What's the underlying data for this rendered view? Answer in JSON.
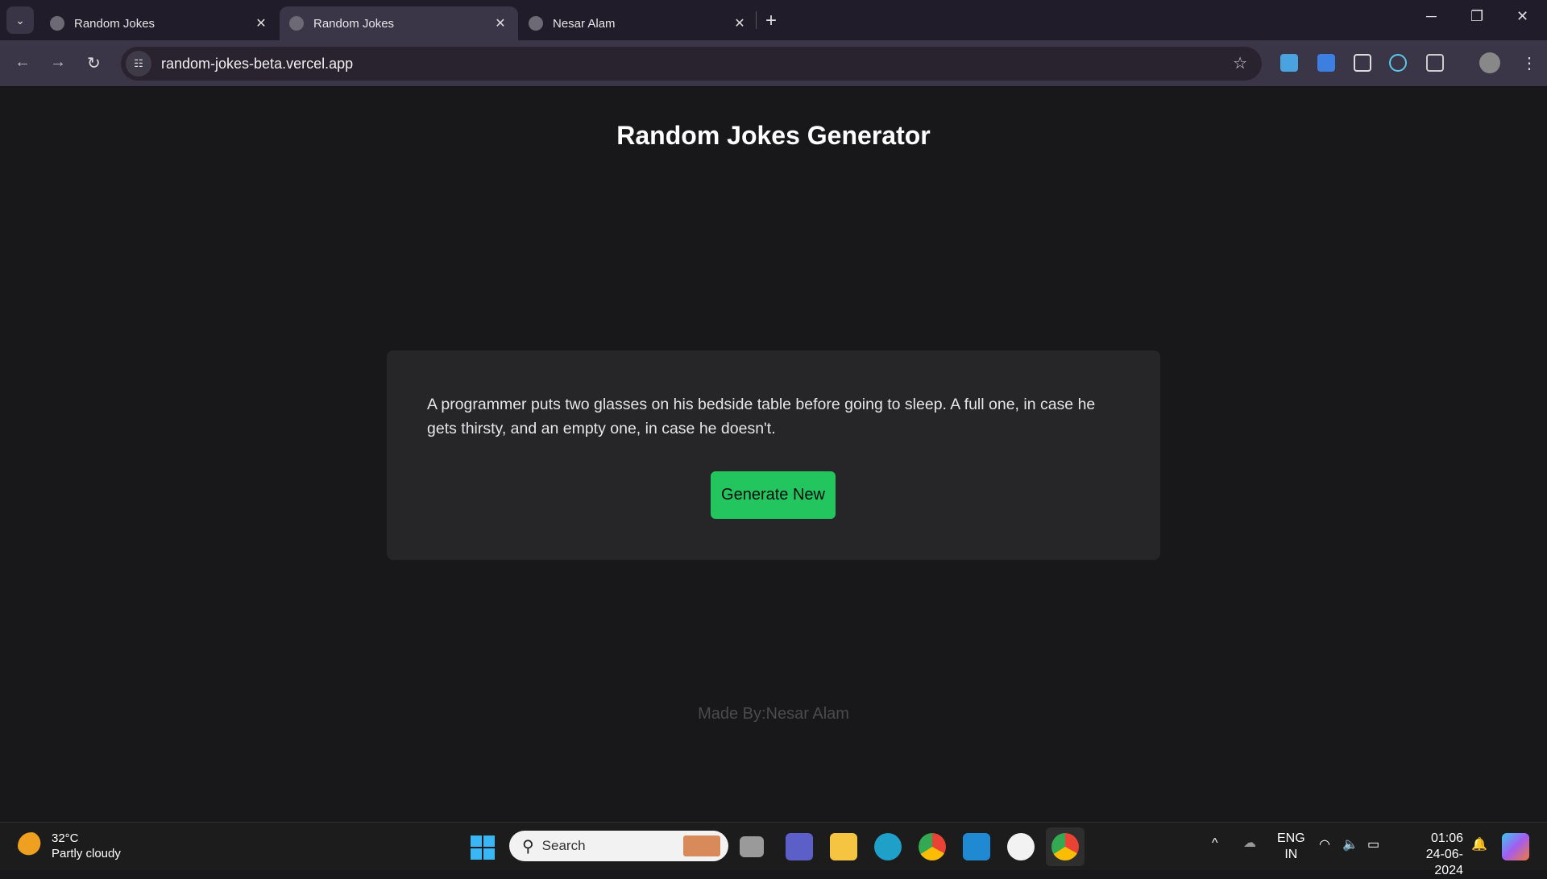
{
  "browser": {
    "tabs": [
      {
        "label": "Random Jokes",
        "active": false
      },
      {
        "label": "Random Jokes",
        "active": true
      },
      {
        "label": "Nesar Alam",
        "active": false
      }
    ],
    "url": "random-jokes-beta.vercel.app"
  },
  "page": {
    "title": "Random Jokes Generator",
    "joke": "A programmer puts two glasses on his bedside table before going to sleep. A full one, in case he gets thirsty, and an empty one, in case he doesn't.",
    "button_label": "Generate New",
    "footer": "Made By:Nesar Alam",
    "accent": "#22c55e"
  },
  "taskbar": {
    "temperature": "32°C",
    "weather": "Partly cloudy",
    "search_placeholder": "Search",
    "lang1": "ENG",
    "lang2": "IN",
    "time": "01:06",
    "date": "24-06-2024"
  }
}
